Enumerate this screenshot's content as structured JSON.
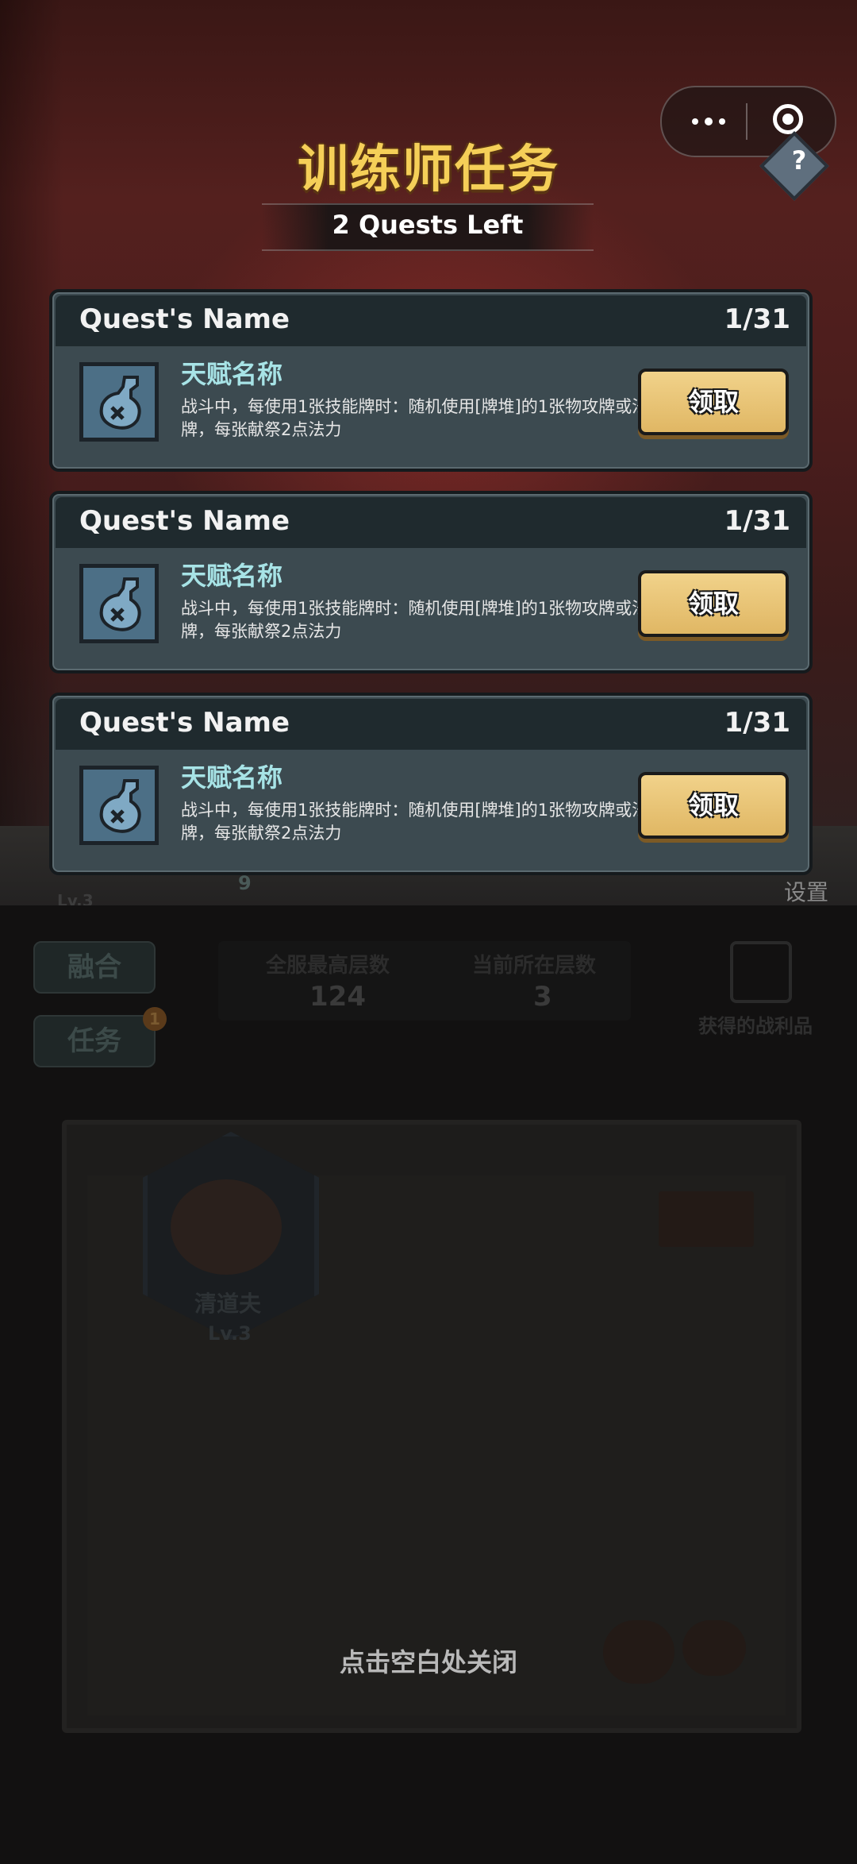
{
  "header": {
    "title": "训练师任务",
    "subtitle": "2 Quests Left",
    "help_symbol": "?"
  },
  "quests": [
    {
      "name": "Quest's Name",
      "progress": "1/31",
      "talent_name": "天赋名称",
      "description": "战斗中，每使用1张技能牌时：随机使用[牌堆]的1张物攻牌或法术牌，每张献祭2点法力",
      "button": "领取",
      "icon": "potion-bottle-icon"
    },
    {
      "name": "Quest's Name",
      "progress": "1/31",
      "talent_name": "天赋名称",
      "description": "战斗中，每使用1张技能牌时：随机使用[牌堆]的1张物攻牌或法术牌，每张献祭2点法力",
      "button": "领取",
      "icon": "potion-bottle-icon"
    },
    {
      "name": "Quest's Name",
      "progress": "1/31",
      "talent_name": "天赋名称",
      "description": "战斗中，每使用1张技能牌时：随机使用[牌堆]的1张物攻牌或法术牌，每张献祭2点法力",
      "button": "领取",
      "icon": "potion-bottle-icon"
    }
  ],
  "background": {
    "level_label": "Lv.3",
    "xp_value": "9",
    "settings_label": "设置",
    "fuse_button": "融合",
    "task_button": "任务",
    "task_badge": "1",
    "stat_max_floor_label": "全服最高层数",
    "stat_max_floor_value": "124",
    "stat_current_floor_label": "当前所在层数",
    "stat_current_floor_value": "3",
    "loot_label": "获得的战利品",
    "hero_name": "清道夫",
    "hero_level": "Lv.3"
  },
  "footer": {
    "close_hint": "点击空白处关闭"
  },
  "colors": {
    "title_gold": "#f5cf58",
    "talent_cyan": "#a7e3e6",
    "button_gold": "#e8c477",
    "card_bg": "#3c4a50"
  }
}
